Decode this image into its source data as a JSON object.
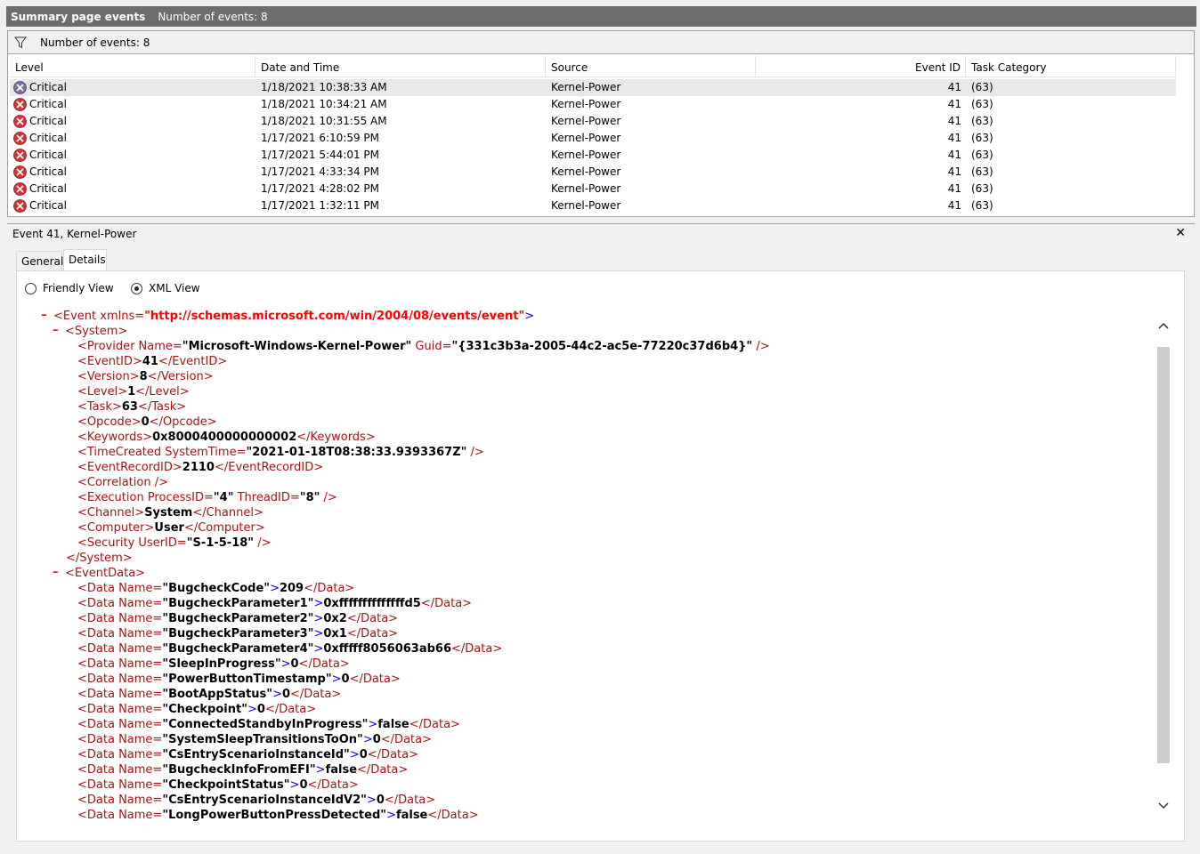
{
  "title_bar": {
    "title": "Summary page events",
    "count_text": "Number of events: 8"
  },
  "filter_bar": {
    "icon": "filter-icon",
    "text": "Number of events: 8"
  },
  "table": {
    "columns": [
      "Level",
      "Date and Time",
      "Source",
      "Event ID",
      "Task Category"
    ],
    "rows": [
      {
        "level": "Critical",
        "datetime": "1/18/2021 10:38:33 AM",
        "source": "Kernel-Power",
        "event_id": "41",
        "task": "(63)",
        "selected": true
      },
      {
        "level": "Critical",
        "datetime": "1/18/2021 10:34:21 AM",
        "source": "Kernel-Power",
        "event_id": "41",
        "task": "(63)",
        "selected": false
      },
      {
        "level": "Critical",
        "datetime": "1/18/2021 10:31:55 AM",
        "source": "Kernel-Power",
        "event_id": "41",
        "task": "(63)",
        "selected": false
      },
      {
        "level": "Critical",
        "datetime": "1/17/2021 6:10:59 PM",
        "source": "Kernel-Power",
        "event_id": "41",
        "task": "(63)",
        "selected": false
      },
      {
        "level": "Critical",
        "datetime": "1/17/2021 5:44:01 PM",
        "source": "Kernel-Power",
        "event_id": "41",
        "task": "(63)",
        "selected": false
      },
      {
        "level": "Critical",
        "datetime": "1/17/2021 4:33:34 PM",
        "source": "Kernel-Power",
        "event_id": "41",
        "task": "(63)",
        "selected": false
      },
      {
        "level": "Critical",
        "datetime": "1/17/2021 4:28:02 PM",
        "source": "Kernel-Power",
        "event_id": "41",
        "task": "(63)",
        "selected": false
      },
      {
        "level": "Critical",
        "datetime": "1/17/2021 1:32:11 PM",
        "source": "Kernel-Power",
        "event_id": "41",
        "task": "(63)",
        "selected": false
      }
    ]
  },
  "detail": {
    "header": "Event 41, Kernel-Power",
    "close_label": "✕",
    "tabs": [
      {
        "label": "General",
        "active": false
      },
      {
        "label": "Details",
        "active": true
      }
    ],
    "view_options": [
      {
        "label": "Friendly View",
        "selected": false
      },
      {
        "label": "XML View",
        "selected": true
      }
    ],
    "xml": {
      "root_open_tag": "<Event xmlns=",
      "root_ns": "\"http://schemas.microsoft.com/win/2004/08/events/event\"",
      "system_open": "<System>",
      "system_close": "</System>",
      "eventdata_open": "<EventData>",
      "system_lines": [
        {
          "pre": "<Provider Name=",
          "v1": "\"Microsoft-Windows-Kernel-Power\"",
          "mid": " Guid=",
          "v2": "\"{331c3b3a-2005-44c2-ac5e-77220c37d6b4}\"",
          "post": " />"
        },
        {
          "pre": "<EventID>",
          "v1": "41",
          "mid": "",
          "v2": "",
          "post": "</EventID>"
        },
        {
          "pre": "<Version>",
          "v1": "8",
          "mid": "",
          "v2": "",
          "post": "</Version>"
        },
        {
          "pre": "<Level>",
          "v1": "1",
          "mid": "",
          "v2": "",
          "post": "</Level>"
        },
        {
          "pre": "<Task>",
          "v1": "63",
          "mid": "",
          "v2": "",
          "post": "</Task>"
        },
        {
          "pre": "<Opcode>",
          "v1": "0",
          "mid": "",
          "v2": "",
          "post": "</Opcode>"
        },
        {
          "pre": "<Keywords>",
          "v1": "0x8000400000000002",
          "mid": "",
          "v2": "",
          "post": "</Keywords>"
        },
        {
          "pre": "<TimeCreated SystemTime=",
          "v1": "\"2021-01-18T08:38:33.9393367Z\"",
          "mid": "",
          "v2": "",
          "post": " />"
        },
        {
          "pre": "<EventRecordID>",
          "v1": "2110",
          "mid": "",
          "v2": "",
          "post": "</EventRecordID>"
        },
        {
          "pre": "<Correlation />",
          "v1": "",
          "mid": "",
          "v2": "",
          "post": ""
        },
        {
          "pre": "<Execution ProcessID=",
          "v1": "\"4\"",
          "mid": " ThreadID=",
          "v2": "\"8\"",
          "post": " />"
        },
        {
          "pre": "<Channel>",
          "v1": "System",
          "mid": "",
          "v2": "",
          "post": "</Channel>"
        },
        {
          "pre": "<Computer>",
          "v1": "User",
          "mid": "",
          "v2": "",
          "post": "</Computer>"
        },
        {
          "pre": "<Security UserID=",
          "v1": "\"S-1-5-18\"",
          "mid": "",
          "v2": "",
          "post": " />"
        }
      ],
      "data_lines": [
        {
          "name": "\"BugcheckCode\"",
          "value": "209"
        },
        {
          "name": "\"BugcheckParameter1\"",
          "value": "0xffffffffffffffd5"
        },
        {
          "name": "\"BugcheckParameter2\"",
          "value": "0x2"
        },
        {
          "name": "\"BugcheckParameter3\"",
          "value": "0x1"
        },
        {
          "name": "\"BugcheckParameter4\"",
          "value": "0xfffff8056063ab66"
        },
        {
          "name": "\"SleepInProgress\"",
          "value": "0"
        },
        {
          "name": "\"PowerButtonTimestamp\"",
          "value": "0"
        },
        {
          "name": "\"BootAppStatus\"",
          "value": "0"
        },
        {
          "name": "\"Checkpoint\"",
          "value": "0"
        },
        {
          "name": "\"ConnectedStandbyInProgress\"",
          "value": "false"
        },
        {
          "name": "\"SystemSleepTransitionsToOn\"",
          "value": "0"
        },
        {
          "name": "\"CsEntryScenarioInstanceId\"",
          "value": "0"
        },
        {
          "name": "\"BugcheckInfoFromEFI\"",
          "value": "false"
        },
        {
          "name": "\"CheckpointStatus\"",
          "value": "0"
        },
        {
          "name": "\"CsEntryScenarioInstanceIdV2\"",
          "value": "0"
        },
        {
          "name": "\"LongPowerButtonPressDetected\"",
          "value": "false"
        }
      ],
      "data_open": "<Data Name=",
      "data_gt": ">",
      "data_close": "</Data>"
    }
  },
  "colors": {
    "title_bar_bg": "#6d6d6d",
    "tag": "#a31515",
    "punct": "#0000ff",
    "namespace": "#ff0000",
    "selected_row": "#e8e8e8"
  }
}
